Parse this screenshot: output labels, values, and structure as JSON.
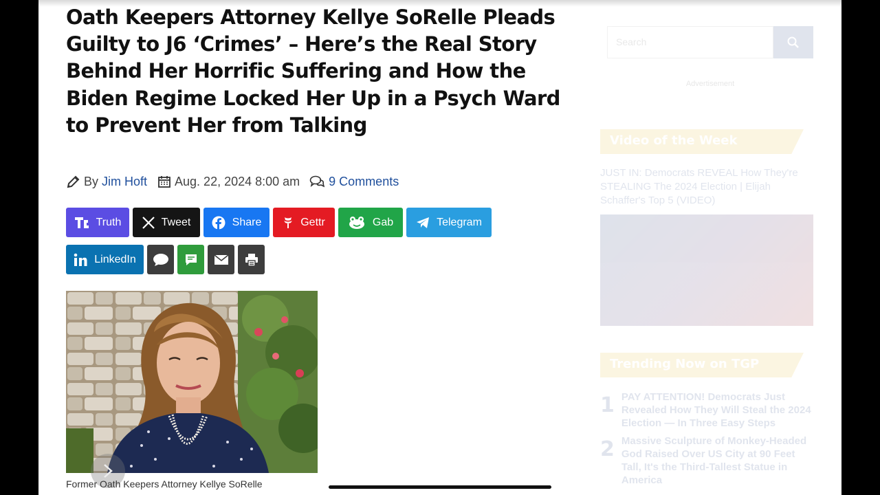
{
  "article": {
    "title": "Oath Keepers Attorney Kellye SoRelle Pleads Guilty to J6 ‘Crimes’ – Here’s the Real Story Behind Her Horrific Suffering and How the Biden Regime Locked Her Up in a Psych Ward to Prevent Her from Talking",
    "by_label": "By",
    "author": "Jim Hoft",
    "date": "Aug. 22, 2024 8:00 am",
    "comments": "9 Comments",
    "photo_caption": "Former Oath Keepers Attorney Kellye SoRelle"
  },
  "share": {
    "row1": [
      {
        "label": "Truth",
        "icon": "truth-social-icon",
        "color": "#5b4de3"
      },
      {
        "label": "Tweet",
        "icon": "x-icon",
        "color": "#151515"
      },
      {
        "label": "Share",
        "icon": "facebook-icon",
        "color": "#1877f2"
      },
      {
        "label": "Gettr",
        "icon": "gettr-icon",
        "color": "#e41b23"
      },
      {
        "label": "Gab",
        "icon": "gab-icon",
        "color": "#21a548"
      },
      {
        "label": "Telegram",
        "icon": "telegram-icon",
        "color": "#2a9ee0"
      }
    ],
    "row2": [
      {
        "label": "LinkedIn",
        "icon": "linkedin-icon",
        "color": "#0a72b1"
      },
      {
        "label": "",
        "icon": "comment-icon",
        "color": "#3d3d3d"
      },
      {
        "label": "",
        "icon": "sms-icon",
        "color": "#2f9c3c"
      },
      {
        "label": "",
        "icon": "email-icon",
        "color": "#3d3d3d"
      },
      {
        "label": "",
        "icon": "print-icon",
        "color": "#3d3d3d"
      }
    ]
  },
  "sidebar": {
    "search_placeholder": "Search",
    "ad_label": "Advertisement",
    "video_heading": "Video of the Week",
    "video_text": "JUST IN: Democrats REVEAL How They're STEALING The 2024 Election | Elijah Schaffer's Top 5 (VIDEO)",
    "trending_heading": "Trending Now on TGP",
    "trending": [
      {
        "num": "1",
        "text": "PAY ATTENTION! Democrats Just Revealed How They Will Steal the 2024 Election — In Three Easy Steps"
      },
      {
        "num": "2",
        "text": "Massive Sculpture of Monkey-Headed God Raised Over US City at 90 Feet Tall, It's the Third-Tallest Statue in America"
      }
    ]
  }
}
